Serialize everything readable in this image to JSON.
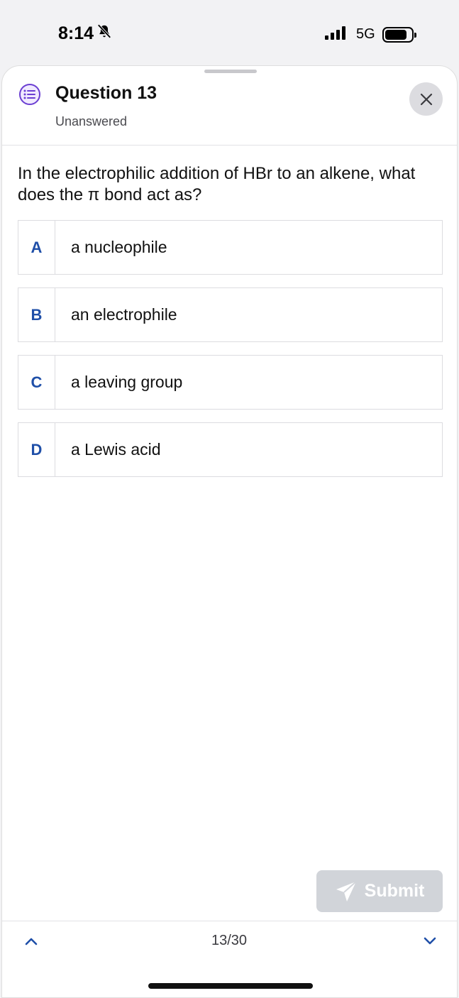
{
  "status_bar": {
    "time": "8:14",
    "network": "5G",
    "battery_level": 0.85
  },
  "header": {
    "title": "Question 13",
    "subtitle": "Unanswered"
  },
  "question": {
    "text": "In the electrophilic addition of HBr to an alkene, what does the π bond act as?"
  },
  "options": [
    {
      "letter": "A",
      "text": "a nucleophile"
    },
    {
      "letter": "B",
      "text": "an electrophile"
    },
    {
      "letter": "C",
      "text": "a leaving group"
    },
    {
      "letter": "D",
      "text": "a Lewis acid"
    }
  ],
  "submit": {
    "label": "Submit",
    "enabled": false
  },
  "footer": {
    "counter": "13/30"
  },
  "colors": {
    "accent": "#1f4fa8",
    "header_icon": "#6b3fd2",
    "submit_disabled": "#d1d4d9"
  },
  "icons": {
    "silent": "bell-slash-icon",
    "signal": "cellular-signal-icon",
    "battery": "battery-icon",
    "header": "chat-list-icon",
    "close": "close-icon",
    "submit": "send-icon",
    "prev": "chevron-up-icon",
    "next": "chevron-down-icon"
  }
}
